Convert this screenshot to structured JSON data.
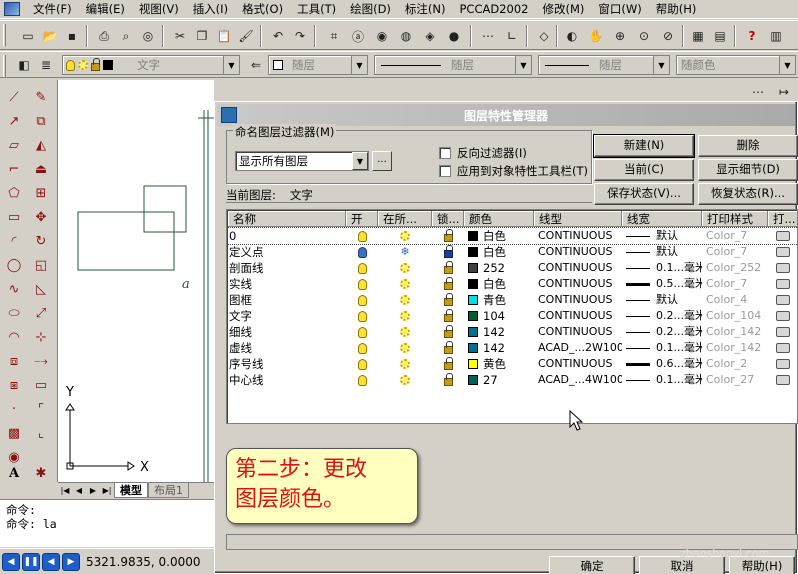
{
  "menu": [
    "文件(F)",
    "编辑(E)",
    "视图(V)",
    "插入(I)",
    "格式(O)",
    "工具(T)",
    "绘图(D)",
    "标注(N)",
    "PCCAD2002",
    "修改(M)",
    "窗口(W)",
    "帮助(H)"
  ],
  "toolbar2": {
    "layer_combo": "文字",
    "color_combo": "随层",
    "linetype_combo": "随层",
    "lineweight_combo": "随层",
    "plotstyle_combo": "随颜色"
  },
  "canvas": {
    "axis_x": "X",
    "axis_y": "Y",
    "marker_a": "a"
  },
  "layout_tabs": {
    "model": "模型",
    "layout": "布局1"
  },
  "command": {
    "line1": "命令:",
    "line2": "命令: la"
  },
  "status": {
    "coords": "5321.9835, 0.0000"
  },
  "dialog": {
    "title": "图层特性管理器",
    "filter_label": "命名图层过滤器(M)",
    "filter_value": "显示所有图层",
    "filter_button": "...",
    "invert_filter": "反向过滤器(I)",
    "apply_toolbar": "应用到对象特性工具栏(T)",
    "buttons": {
      "new": "新建(N)",
      "delete": "删除",
      "current": "当前(C)",
      "show_details": "显示细节(D)",
      "save_state": "保存状态(V)...",
      "restore_state": "恢复状态(R)...",
      "ok": "确定",
      "cancel": "取消",
      "help": "帮助(H)"
    },
    "current_layer_label": "当前图层:",
    "current_layer_value": "文字",
    "columns": [
      "名称",
      "开",
      "在所...",
      "锁...",
      "颜色",
      "线型",
      "线宽",
      "打印样式",
      "打..."
    ],
    "layers": [
      {
        "name": "0",
        "on": true,
        "frozen": false,
        "locked": false,
        "color_hex": "#000000",
        "color_name": "白色",
        "linetype": "CONTINUOUS",
        "lineweight": "默认",
        "thick": false,
        "plot_style": "Color_7"
      },
      {
        "name": "定义点",
        "on": false,
        "frozen": true,
        "locked": true,
        "color_hex": "#000000",
        "color_name": "白色",
        "linetype": "CONTINUOUS",
        "lineweight": "默认",
        "thick": false,
        "plot_style": "Color_7"
      },
      {
        "name": "剖面线",
        "on": true,
        "frozen": false,
        "locked": false,
        "color_hex": "#404040",
        "color_name": "252",
        "linetype": "CONTINUOUS",
        "lineweight": "0.1...毫米",
        "thick": false,
        "plot_style": "Color_252"
      },
      {
        "name": "实线",
        "on": true,
        "frozen": false,
        "locked": false,
        "color_hex": "#000000",
        "color_name": "白色",
        "linetype": "CONTINUOUS",
        "lineweight": "0.5...毫米",
        "thick": true,
        "plot_style": "Color_7"
      },
      {
        "name": "图框",
        "on": true,
        "frozen": false,
        "locked": false,
        "color_hex": "#00e0e0",
        "color_name": "青色",
        "linetype": "CONTINUOUS",
        "lineweight": "默认",
        "thick": false,
        "plot_style": "Color_4"
      },
      {
        "name": "文字",
        "on": true,
        "frozen": false,
        "locked": false,
        "color_hex": "#006030",
        "color_name": "104",
        "linetype": "CONTINUOUS",
        "lineweight": "0.2...毫米",
        "thick": false,
        "plot_style": "Color_104"
      },
      {
        "name": "细线",
        "on": true,
        "frozen": false,
        "locked": false,
        "color_hex": "#007090",
        "color_name": "142",
        "linetype": "CONTINUOUS",
        "lineweight": "0.2...毫米",
        "thick": false,
        "plot_style": "Color_142"
      },
      {
        "name": "虚线",
        "on": true,
        "frozen": false,
        "locked": false,
        "color_hex": "#007090",
        "color_name": "142",
        "linetype": "ACAD_...2W100",
        "lineweight": "0.1...毫米",
        "thick": false,
        "plot_style": "Color_142"
      },
      {
        "name": "序号线",
        "on": true,
        "frozen": false,
        "locked": false,
        "color_hex": "#ffff00",
        "color_name": "黄色",
        "linetype": "CONTINUOUS",
        "lineweight": "0.6...毫米",
        "thick": true,
        "plot_style": "Color_2"
      },
      {
        "name": "中心线",
        "on": true,
        "frozen": false,
        "locked": false,
        "color_hex": "#006060",
        "color_name": "27",
        "linetype": "ACAD_...4W100",
        "lineweight": "0.1...毫米",
        "thick": false,
        "plot_style": "Color_27"
      }
    ]
  },
  "annotation": {
    "line1": "第二步：更改",
    "line2": "图层颜色。"
  },
  "watermark": "zhanshaoyi.com",
  "colors": {
    "annotation_text": "#e01010",
    "annotation_bg": "#ffffc0",
    "canvas_lines": "#1f5a3a"
  }
}
